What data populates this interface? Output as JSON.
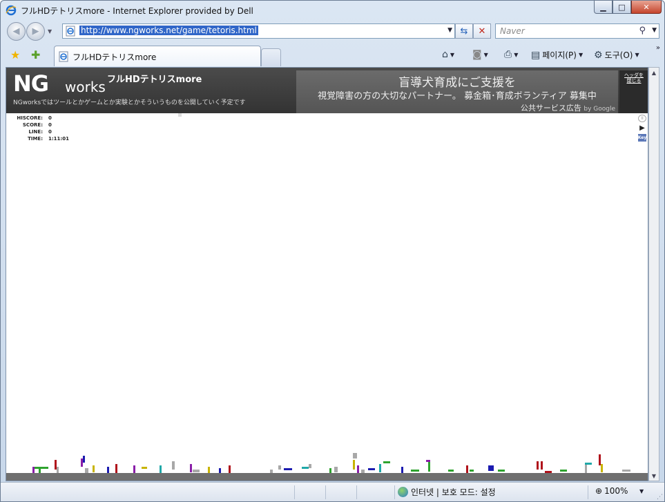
{
  "window": {
    "title": "フルHDテトリスmore - Internet Explorer provided by Dell",
    "caption_min": "▁",
    "caption_max": "□",
    "caption_close": "✕"
  },
  "nav": {
    "back_glyph": "◀",
    "forward_glyph": "▶",
    "dropdown_glyph": "▼",
    "address": "http://www.ngworks.net/game/tetoris.html",
    "refresh_glyph": "⇆",
    "stop_glyph": "✕",
    "search_placeholder": "Naver",
    "search_glyph": "⚲"
  },
  "tabs": {
    "favorites_glyph": "★",
    "add_favorite_glyph": "✚",
    "active_tab_label": "フルHDテトリスmore",
    "home_glyph": "⌂",
    "feeds_glyph": "◙",
    "print_glyph": "⎙",
    "page_label": "페이지(P)",
    "tools_label": "도구(O)",
    "tools_glyph": "⚙",
    "more_glyph": "»"
  },
  "page": {
    "logo_ng": "NG",
    "logo_works": "works",
    "site_title": "フルHDテトリスmore",
    "tagline": "NGworksではツールとかゲームとか実験とかそういうものを公開していく予定です",
    "ad": {
      "headline": "盲導犬育成にご支援を",
      "body": "視覚障害の方の大切なパートナー。 募金箱･育成ボランティア 募集中",
      "footer": "公共サービス広告",
      "by_google": "by Google",
      "side_text": "ヘッダを閉じる"
    },
    "stats": [
      {
        "label": "HISCORE:",
        "value": "0"
      },
      {
        "label": "SCORE:",
        "value": "0"
      },
      {
        "label": "LINE:",
        "value": "0"
      },
      {
        "label": "TIME:",
        "value": "1:11:01"
      }
    ],
    "controls": {
      "pause_glyph": "II",
      "play_glyph": "▶",
      "key_label": "Key"
    }
  },
  "status": {
    "zone_text": "인터넷 | 보호 모드: 설정",
    "zoom_text": "100%",
    "zoom_glyph": "⊕",
    "dropdown_glyph": "▼",
    "grip_glyph": "⋰"
  },
  "colors": {
    "banner": "#3f3f3f",
    "ad_background": "#5f5f5f",
    "floor": "#6f6f6f",
    "piece_purple": "#8a1ea8",
    "piece_green": "#2ea32e",
    "piece_red": "#b0121b",
    "piece_blue": "#1b1bb0",
    "piece_yellow": "#c8b400",
    "piece_cyan": "#1fa8a8",
    "piece_gray": "#a8a8a8"
  }
}
